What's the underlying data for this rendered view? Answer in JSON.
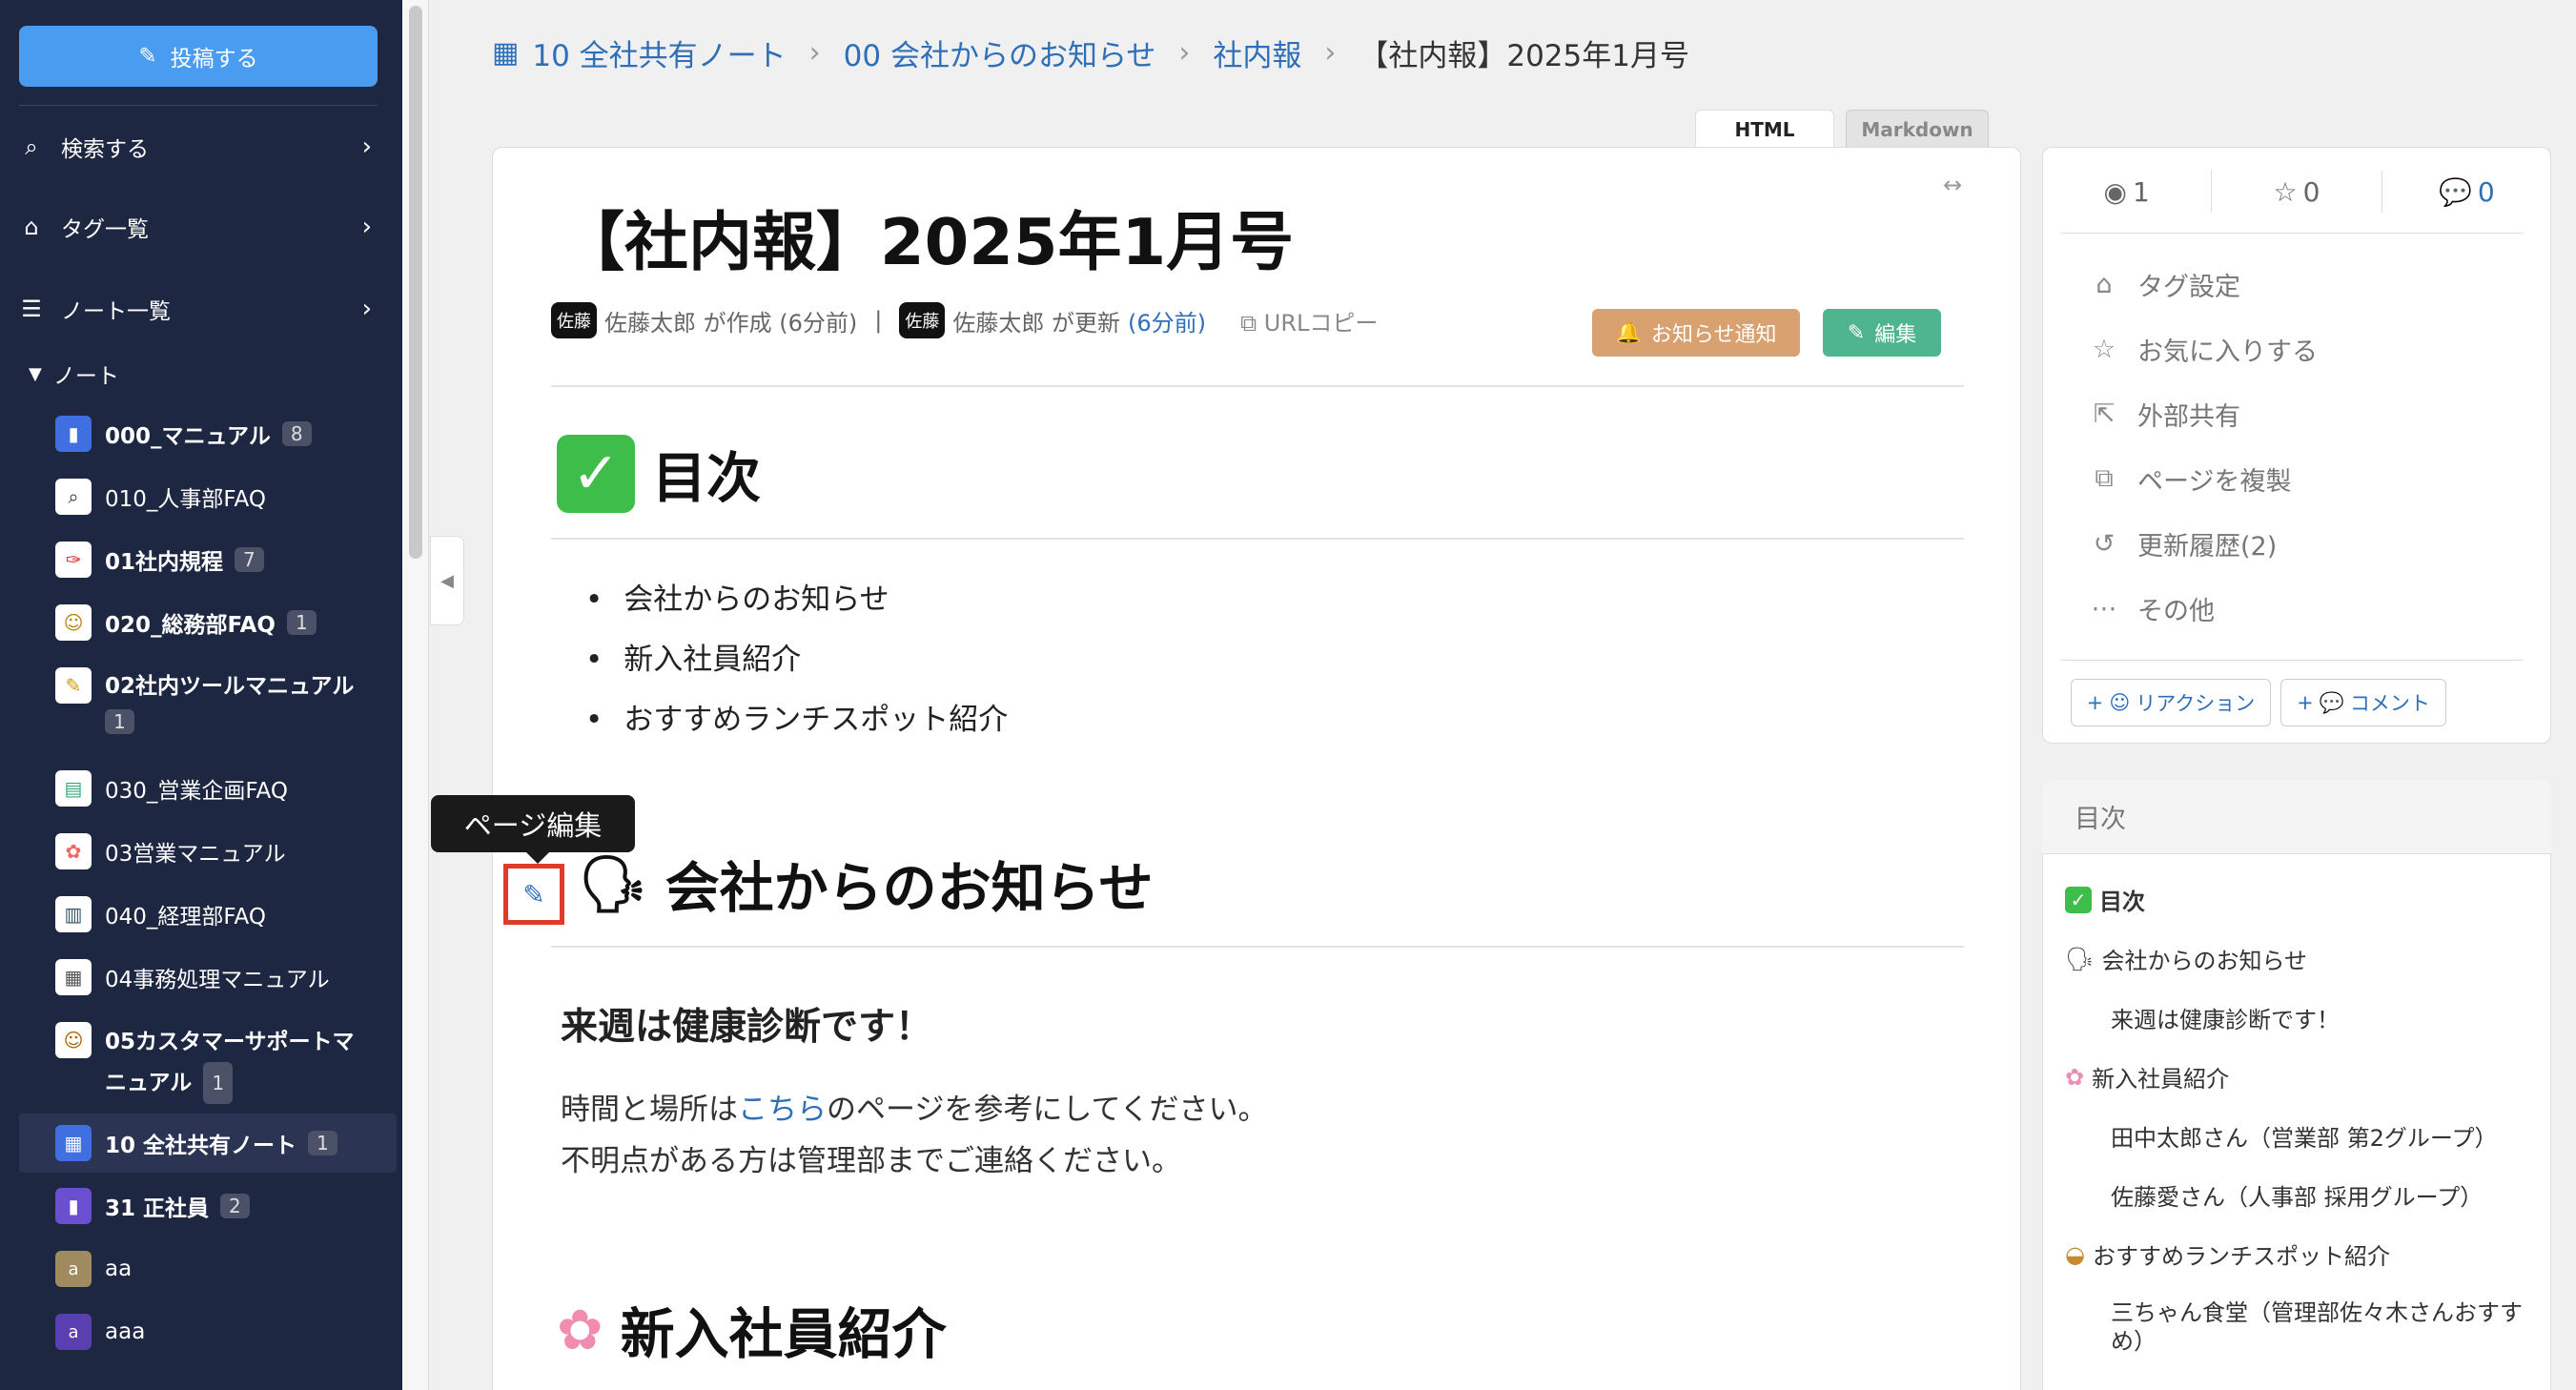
{
  "sidebar": {
    "post_button": "投稿する",
    "nav": [
      {
        "label": "検索する"
      },
      {
        "label": "タグ一覧"
      },
      {
        "label": "ノート一覧"
      }
    ],
    "tree_header": "ノート",
    "notes": [
      {
        "label": "000_マニュアル",
        "badge": "8",
        "bold": true,
        "icon": "blue-book-icon",
        "color": "#3f6fe0"
      },
      {
        "label": "010_人事部FAQ",
        "badge": "",
        "bold": false,
        "icon": "magnifier-icon",
        "color": "#ffffff"
      },
      {
        "label": "01社内規程",
        "badge": "7",
        "bold": true,
        "icon": "pushpin-icon",
        "color": "#ffffff"
      },
      {
        "label": "020_総務部FAQ",
        "badge": "1",
        "bold": true,
        "icon": "worker-icon",
        "color": "#ffffff"
      },
      {
        "label": "02社内ツールマニュアル",
        "badge": "1",
        "bold": true,
        "icon": "memo-icon",
        "color": "#ffffff"
      },
      {
        "label": "030_営業企画FAQ",
        "badge": "",
        "bold": false,
        "icon": "books-icon",
        "color": "#ffffff"
      },
      {
        "label": "03営業マニュアル",
        "badge": "",
        "bold": false,
        "icon": "palette-icon",
        "color": "#ffffff"
      },
      {
        "label": "040_経理部FAQ",
        "badge": "",
        "bold": false,
        "icon": "chart-icon",
        "color": "#ffffff"
      },
      {
        "label": "04事務処理マニュアル",
        "badge": "",
        "bold": false,
        "icon": "calculator-icon",
        "color": "#ffffff"
      },
      {
        "label": "05カスタマーサポートマニュアル",
        "badge": "1",
        "bold": true,
        "icon": "support-agent-icon",
        "color": "#ffffff"
      },
      {
        "label": "10 全社共有ノート",
        "badge": "1",
        "bold": true,
        "icon": "building-icon",
        "color": "#3f6fe0"
      },
      {
        "label": "31 正社員",
        "badge": "2",
        "bold": true,
        "icon": "purple-book-icon",
        "color": "#6a4fd0"
      },
      {
        "label": "aa",
        "badge": "",
        "bold": false,
        "icon": "letter-a-icon",
        "color": "#a08a60"
      },
      {
        "label": "aaa",
        "badge": "",
        "bold": false,
        "icon": "letter-a-icon",
        "color": "#5a3fb0"
      }
    ]
  },
  "breadcrumb": [
    "10 全社共有ノート",
    "00 会社からのお知らせ",
    "社内報",
    "【社内報】2025年1月号"
  ],
  "view_tabs": {
    "html": "HTML",
    "markdown": "Markdown"
  },
  "page": {
    "title": "【社内報】2025年1月号",
    "meta": {
      "avatar": "佐藤",
      "created_by": "佐藤太郎 が作成 (6分前)",
      "pipe": "|",
      "updated_by": "佐藤太郎 が更新",
      "updated_ago": "(6分前)",
      "url_copy": "URLコピー"
    },
    "notify_button": "お知らせ通知",
    "edit_button": "編集",
    "toc_heading": "目次",
    "toc_items": [
      "会社からのお知らせ",
      "新入社員紹介",
      "おすすめランチスポット紹介"
    ],
    "tooltip": "ページ編集",
    "section1_heading": "会社からのお知らせ",
    "section1_sub": "来週は健康診断です！",
    "section1_p1_pre": "時間と場所は",
    "section1_p1_link": "こちら",
    "section1_p1_post": "のページを参考にしてください。",
    "section1_p2": "不明点がある方は管理部までご連絡ください。",
    "section2_heading": "新入社員紹介"
  },
  "right": {
    "views": "1",
    "stars": "0",
    "comments": "0",
    "actions": [
      "タグ設定",
      "お気に入りする",
      "外部共有",
      "ページを複製",
      "更新履歴(2)",
      "その他"
    ],
    "reaction_btn": "リアクション",
    "comment_btn": "コメント",
    "toc_title": "目次",
    "toc": [
      {
        "label": "目次",
        "level": 1
      },
      {
        "label": "会社からのお知らせ",
        "level": 1
      },
      {
        "label": "来週は健康診断です！",
        "level": 2
      },
      {
        "label": "新入社員紹介",
        "level": 1
      },
      {
        "label": "田中太郎さん（営業部 第2グループ）",
        "level": 2
      },
      {
        "label": "佐藤愛さん（人事部 採用グループ）",
        "level": 2
      },
      {
        "label": "おすすめランチスポット紹介",
        "level": 1
      },
      {
        "label": "三ちゃん食堂（管理部佐々木さんおすすめ）",
        "level": 2
      }
    ]
  }
}
